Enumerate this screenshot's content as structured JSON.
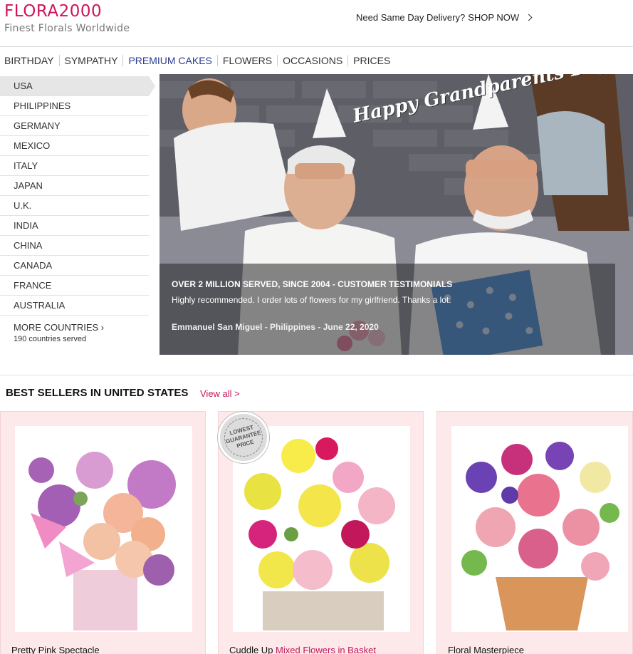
{
  "header": {
    "logo": "FLORA2000",
    "tagline": "Finest Florals Worldwide",
    "promo_text": "Need Same Day Delivery?",
    "promo_link": "SHOP NOW"
  },
  "nav": {
    "items": [
      "BIRTHDAY",
      "SYMPATHY",
      "PREMIUM CAKES",
      "FLOWERS",
      "OCCASIONS",
      "PRICES"
    ],
    "active": "PREMIUM CAKES"
  },
  "sidebar": {
    "countries": [
      "USA",
      "PHILIPPINES",
      "GERMANY",
      "MEXICO",
      "ITALY",
      "JAPAN",
      "U.K.",
      "INDIA",
      "CHINA",
      "CANADA",
      "FRANCE",
      "AUSTRALIA"
    ],
    "selected": "USA",
    "more_label": "MORE COUNTRIES ›",
    "more_sub": "190 countries served"
  },
  "hero": {
    "script_text": "Happy Grandparents Day",
    "testimonial_title": "OVER 2 MILLION SERVED, SINCE 2004 - CUSTOMER TESTIMONIALS",
    "testimonial_quote": "Highly recommended. I order lots of flowers for my girlfriend. Thanks a lot.",
    "testimonial_signature": "Emmanuel San Miguel - Philippines - June 22, 2020"
  },
  "best_sellers": {
    "heading": "BEST SELLERS IN UNITED STATES",
    "view_all": "View all >",
    "products": [
      {
        "name": "Pretty Pink Spectacle",
        "accent": ""
      },
      {
        "name": "Cuddle Up ",
        "accent": "Mixed Flowers in Basket"
      },
      {
        "name": "Floral Masterpiece",
        "accent": ""
      }
    ],
    "badge_top": "LOWEST",
    "badge_mid": "GUARANTEE",
    "badge_bottom": "PRICE"
  },
  "colors": {
    "brand": "#d1135b",
    "nav_active": "#2b3b8e",
    "card_bg": "#fde8ea"
  }
}
